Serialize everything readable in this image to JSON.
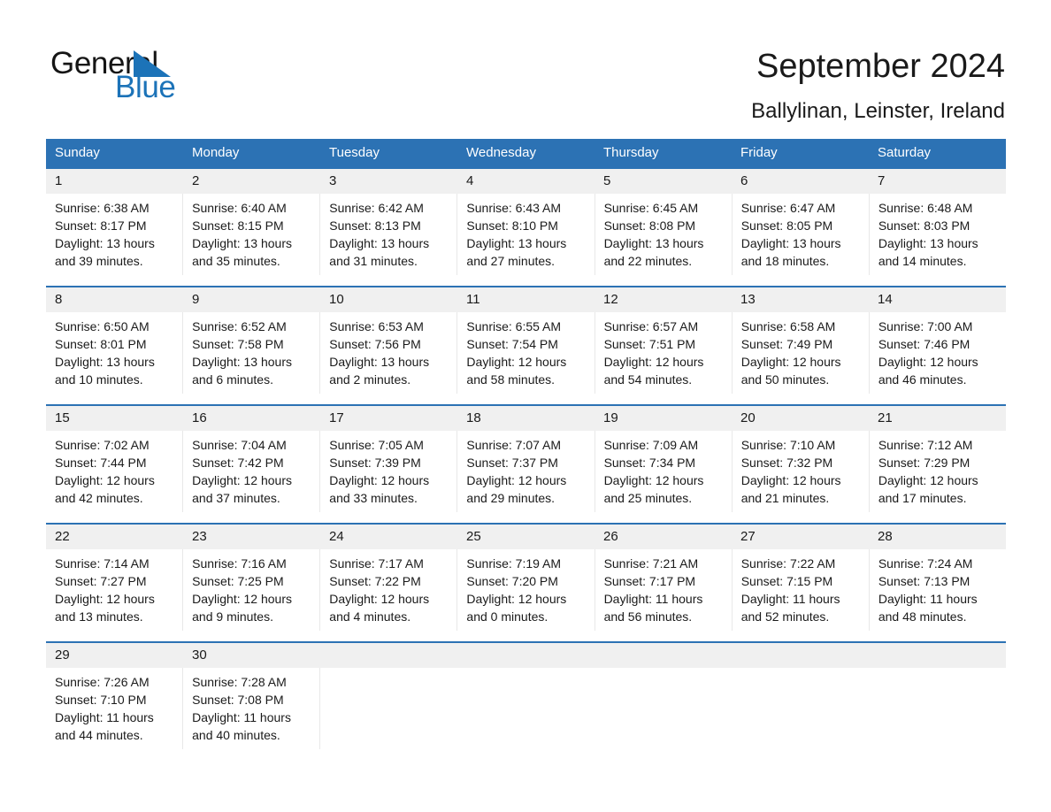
{
  "logo": {
    "word1": "General",
    "word2": "Blue",
    "triangle_color": "#1c73b8"
  },
  "header": {
    "title": "September 2024",
    "subtitle": "Ballylinan, Leinster, Ireland"
  },
  "theme": {
    "header_blue": "#2c72b4",
    "daynum_band": "#f0f0f0",
    "text": "#1a1a1a"
  },
  "calendar": {
    "weekday_headers": [
      "Sunday",
      "Monday",
      "Tuesday",
      "Wednesday",
      "Thursday",
      "Friday",
      "Saturday"
    ],
    "weeks": [
      [
        {
          "day": "1",
          "lines": [
            "Sunrise: 6:38 AM",
            "Sunset: 8:17 PM",
            "Daylight: 13 hours",
            "and 39 minutes."
          ]
        },
        {
          "day": "2",
          "lines": [
            "Sunrise: 6:40 AM",
            "Sunset: 8:15 PM",
            "Daylight: 13 hours",
            "and 35 minutes."
          ]
        },
        {
          "day": "3",
          "lines": [
            "Sunrise: 6:42 AM",
            "Sunset: 8:13 PM",
            "Daylight: 13 hours",
            "and 31 minutes."
          ]
        },
        {
          "day": "4",
          "lines": [
            "Sunrise: 6:43 AM",
            "Sunset: 8:10 PM",
            "Daylight: 13 hours",
            "and 27 minutes."
          ]
        },
        {
          "day": "5",
          "lines": [
            "Sunrise: 6:45 AM",
            "Sunset: 8:08 PM",
            "Daylight: 13 hours",
            "and 22 minutes."
          ]
        },
        {
          "day": "6",
          "lines": [
            "Sunrise: 6:47 AM",
            "Sunset: 8:05 PM",
            "Daylight: 13 hours",
            "and 18 minutes."
          ]
        },
        {
          "day": "7",
          "lines": [
            "Sunrise: 6:48 AM",
            "Sunset: 8:03 PM",
            "Daylight: 13 hours",
            "and 14 minutes."
          ]
        }
      ],
      [
        {
          "day": "8",
          "lines": [
            "Sunrise: 6:50 AM",
            "Sunset: 8:01 PM",
            "Daylight: 13 hours",
            "and 10 minutes."
          ]
        },
        {
          "day": "9",
          "lines": [
            "Sunrise: 6:52 AM",
            "Sunset: 7:58 PM",
            "Daylight: 13 hours",
            "and 6 minutes."
          ]
        },
        {
          "day": "10",
          "lines": [
            "Sunrise: 6:53 AM",
            "Sunset: 7:56 PM",
            "Daylight: 13 hours",
            "and 2 minutes."
          ]
        },
        {
          "day": "11",
          "lines": [
            "Sunrise: 6:55 AM",
            "Sunset: 7:54 PM",
            "Daylight: 12 hours",
            "and 58 minutes."
          ]
        },
        {
          "day": "12",
          "lines": [
            "Sunrise: 6:57 AM",
            "Sunset: 7:51 PM",
            "Daylight: 12 hours",
            "and 54 minutes."
          ]
        },
        {
          "day": "13",
          "lines": [
            "Sunrise: 6:58 AM",
            "Sunset: 7:49 PM",
            "Daylight: 12 hours",
            "and 50 minutes."
          ]
        },
        {
          "day": "14",
          "lines": [
            "Sunrise: 7:00 AM",
            "Sunset: 7:46 PM",
            "Daylight: 12 hours",
            "and 46 minutes."
          ]
        }
      ],
      [
        {
          "day": "15",
          "lines": [
            "Sunrise: 7:02 AM",
            "Sunset: 7:44 PM",
            "Daylight: 12 hours",
            "and 42 minutes."
          ]
        },
        {
          "day": "16",
          "lines": [
            "Sunrise: 7:04 AM",
            "Sunset: 7:42 PM",
            "Daylight: 12 hours",
            "and 37 minutes."
          ]
        },
        {
          "day": "17",
          "lines": [
            "Sunrise: 7:05 AM",
            "Sunset: 7:39 PM",
            "Daylight: 12 hours",
            "and 33 minutes."
          ]
        },
        {
          "day": "18",
          "lines": [
            "Sunrise: 7:07 AM",
            "Sunset: 7:37 PM",
            "Daylight: 12 hours",
            "and 29 minutes."
          ]
        },
        {
          "day": "19",
          "lines": [
            "Sunrise: 7:09 AM",
            "Sunset: 7:34 PM",
            "Daylight: 12 hours",
            "and 25 minutes."
          ]
        },
        {
          "day": "20",
          "lines": [
            "Sunrise: 7:10 AM",
            "Sunset: 7:32 PM",
            "Daylight: 12 hours",
            "and 21 minutes."
          ]
        },
        {
          "day": "21",
          "lines": [
            "Sunrise: 7:12 AM",
            "Sunset: 7:29 PM",
            "Daylight: 12 hours",
            "and 17 minutes."
          ]
        }
      ],
      [
        {
          "day": "22",
          "lines": [
            "Sunrise: 7:14 AM",
            "Sunset: 7:27 PM",
            "Daylight: 12 hours",
            "and 13 minutes."
          ]
        },
        {
          "day": "23",
          "lines": [
            "Sunrise: 7:16 AM",
            "Sunset: 7:25 PM",
            "Daylight: 12 hours",
            "and 9 minutes."
          ]
        },
        {
          "day": "24",
          "lines": [
            "Sunrise: 7:17 AM",
            "Sunset: 7:22 PM",
            "Daylight: 12 hours",
            "and 4 minutes."
          ]
        },
        {
          "day": "25",
          "lines": [
            "Sunrise: 7:19 AM",
            "Sunset: 7:20 PM",
            "Daylight: 12 hours",
            "and 0 minutes."
          ]
        },
        {
          "day": "26",
          "lines": [
            "Sunrise: 7:21 AM",
            "Sunset: 7:17 PM",
            "Daylight: 11 hours",
            "and 56 minutes."
          ]
        },
        {
          "day": "27",
          "lines": [
            "Sunrise: 7:22 AM",
            "Sunset: 7:15 PM",
            "Daylight: 11 hours",
            "and 52 minutes."
          ]
        },
        {
          "day": "28",
          "lines": [
            "Sunrise: 7:24 AM",
            "Sunset: 7:13 PM",
            "Daylight: 11 hours",
            "and 48 minutes."
          ]
        }
      ],
      [
        {
          "day": "29",
          "lines": [
            "Sunrise: 7:26 AM",
            "Sunset: 7:10 PM",
            "Daylight: 11 hours",
            "and 44 minutes."
          ]
        },
        {
          "day": "30",
          "lines": [
            "Sunrise: 7:28 AM",
            "Sunset: 7:08 PM",
            "Daylight: 11 hours",
            "and 40 minutes."
          ]
        },
        {
          "day": "",
          "lines": []
        },
        {
          "day": "",
          "lines": []
        },
        {
          "day": "",
          "lines": []
        },
        {
          "day": "",
          "lines": []
        },
        {
          "day": "",
          "lines": []
        }
      ]
    ]
  }
}
